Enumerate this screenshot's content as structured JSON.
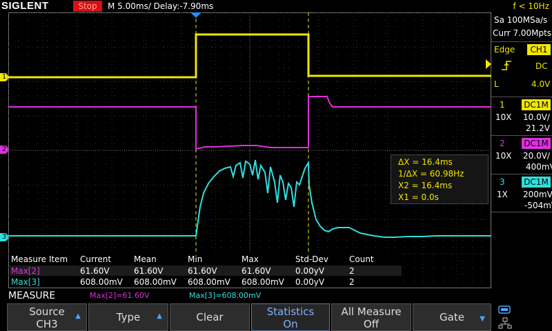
{
  "header": {
    "brand": "SIGLENT",
    "run_state": "Stop",
    "timebase": "M 5.00ms/ Delay:-7.90ms",
    "freq": "f < 10Hz"
  },
  "acquisition": {
    "sample_rate": "Sa 100MSa/s",
    "memory": "Curr 7.00Mpts"
  },
  "trigger": {
    "type": "Edge",
    "source": "CH1",
    "coupling": "DC",
    "slope_label": "L",
    "level": "4.0V"
  },
  "channels": [
    {
      "num": "1",
      "coupling": "DC1M",
      "probe": "10X",
      "scale": "10.0V/",
      "offset": "21.2V",
      "color": "#f2e600"
    },
    {
      "num": "2",
      "coupling": "DC1M",
      "probe": "10X",
      "scale": "20.0V/",
      "offset": "400mV",
      "color": "#e030e0"
    },
    {
      "num": "3",
      "coupling": "DC1M",
      "probe": "1X",
      "scale": "200mV/",
      "offset": "-504mV",
      "color": "#30e0e0"
    }
  ],
  "cursors": {
    "delta_x": "ΔX = 16.4ms",
    "inv_delta_x": "1/ΔX = 60.98Hz",
    "x2": "X2 = 16.4ms",
    "x1": "X1 = 0.0s"
  },
  "measure_table": {
    "headers": [
      "Measure Item",
      "Current",
      "Mean",
      "Min",
      "Max",
      "Std-Dev",
      "Count"
    ],
    "rows": [
      {
        "item": "Max[2]",
        "current": "61.60V",
        "mean": "61.60V",
        "min": "61.60V",
        "max": "61.60V",
        "stddev": "0.00yV",
        "count": "2"
      },
      {
        "item": "Max[3]",
        "current": "608.00mV",
        "mean": "608.00mV",
        "min": "608.00mV",
        "max": "608.00mV",
        "stddev": "0.00yV",
        "count": "2"
      }
    ]
  },
  "status_line": {
    "menu": "MEASURE",
    "m1": "Max[2]=61.60V",
    "m2": "Max[3]=608.00mV"
  },
  "softkeys": {
    "source_l1": "Source",
    "source_l2": "CH3",
    "type": "Type",
    "clear": "Clear",
    "statistics_l1": "Statistics",
    "statistics_l2": "On",
    "allmeasure_l1": "All Measure",
    "allmeasure_l2": "Off",
    "gate": "Gate"
  },
  "markers": {
    "ch1": "1",
    "ch2": "2",
    "ch3": "3"
  },
  "icons": {
    "usb": "usb-icon",
    "network": "network-icon"
  }
}
